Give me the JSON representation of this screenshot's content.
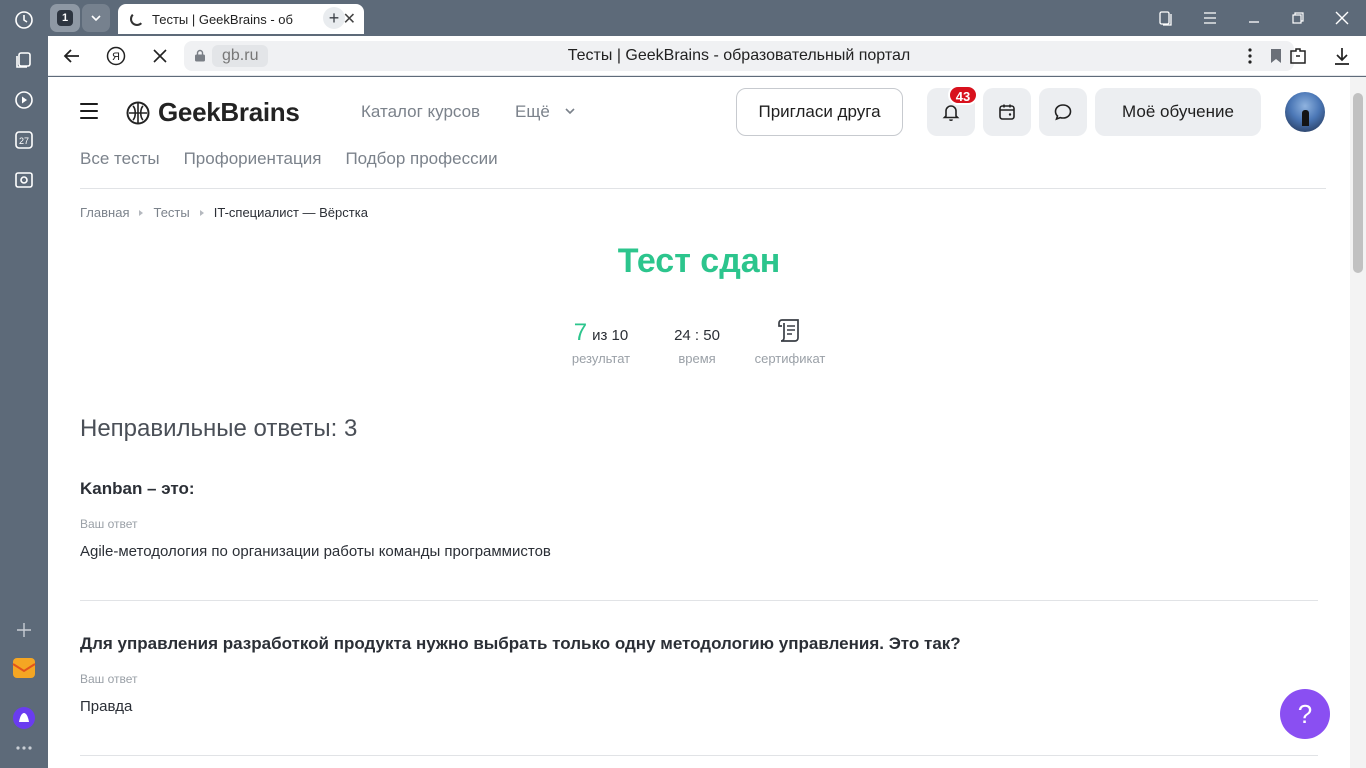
{
  "browser": {
    "tab_counter": "1",
    "active_tab_title": "Тесты | GeekBrains - об",
    "new_tab_label": "+",
    "domain": "gb.ru",
    "page_title": "Тесты | GeekBrains - образовательный портал",
    "sidepanel_calendar_day": "27"
  },
  "site": {
    "logo_text": "GeekBrains",
    "nav": {
      "catalog": "Каталог курсов",
      "more": "Ещё"
    },
    "invite_button": "Пригласи друга",
    "notifications_count": "43",
    "my_learning_button": "Моё обучение",
    "subnav": [
      "Все тесты",
      "Профориентация",
      "Подбор профессии"
    ]
  },
  "breadcrumb": [
    "Главная",
    "Тесты",
    "IT-специалист — Вёрстка"
  ],
  "result": {
    "title": "Тест сдан",
    "score": "7",
    "score_of": "из 10",
    "score_label": "результат",
    "time": "24 : 50",
    "time_label": "время",
    "certificate_label": "сертификат"
  },
  "wrong_answers_heading": "Неправильные ответы: 3",
  "questions": [
    {
      "text": "Kanban – это:",
      "answer_label": "Ваш ответ",
      "answer": "Agile-методология по организации работы команды программистов"
    },
    {
      "text": "Для управления разработкой продукта нужно выбрать только одну методологию управления. Это так?",
      "answer_label": "Ваш ответ",
      "answer": "Правда"
    }
  ],
  "help_button": "?",
  "colors": {
    "accent_green": "#2cc58d",
    "badge_red": "#d8111d",
    "help_purple": "#8a4ff2"
  }
}
